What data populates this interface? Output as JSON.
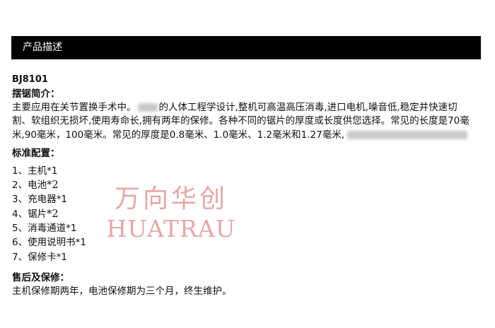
{
  "header": {
    "title": "产品描述"
  },
  "product": {
    "model": "BJ8101",
    "intro_heading": "摆锯简介：",
    "intro_part1": "主要应用在关节置换手术中。",
    "intro_part2": "的人体工程学设计,整机可高温高压消毒,进口电机,噪音低,稳定并快速切割、软组织无损坏,使用寿命长,拥有两年的保修。各种不同的锯片的厚度或长度供您选择。常见的长度是70毫米,90毫米，100毫米。常见的厚度是0.8毫米、1.0毫米、1.2毫米和1.27毫米,"
  },
  "config": {
    "heading": "标准配置：",
    "items": [
      {
        "label": "1、主机",
        "qty": "*1"
      },
      {
        "label": "2、电池",
        "qty": "*2"
      },
      {
        "label": "3、充电器",
        "qty": "*1"
      },
      {
        "label": "4、锯片",
        "qty": "*2"
      },
      {
        "label": "5、消毒通道",
        "qty": "*1"
      },
      {
        "label": "6、使用说明书",
        "qty": "*1"
      },
      {
        "label": "7、保修卡",
        "qty": "*1"
      }
    ]
  },
  "warranty": {
    "heading": "售后及保修：",
    "text": "主机保修期两年，电池保修期为三个月，终生维护。"
  },
  "watermark": {
    "cn": "万向华创",
    "en": "HUATRAU"
  }
}
